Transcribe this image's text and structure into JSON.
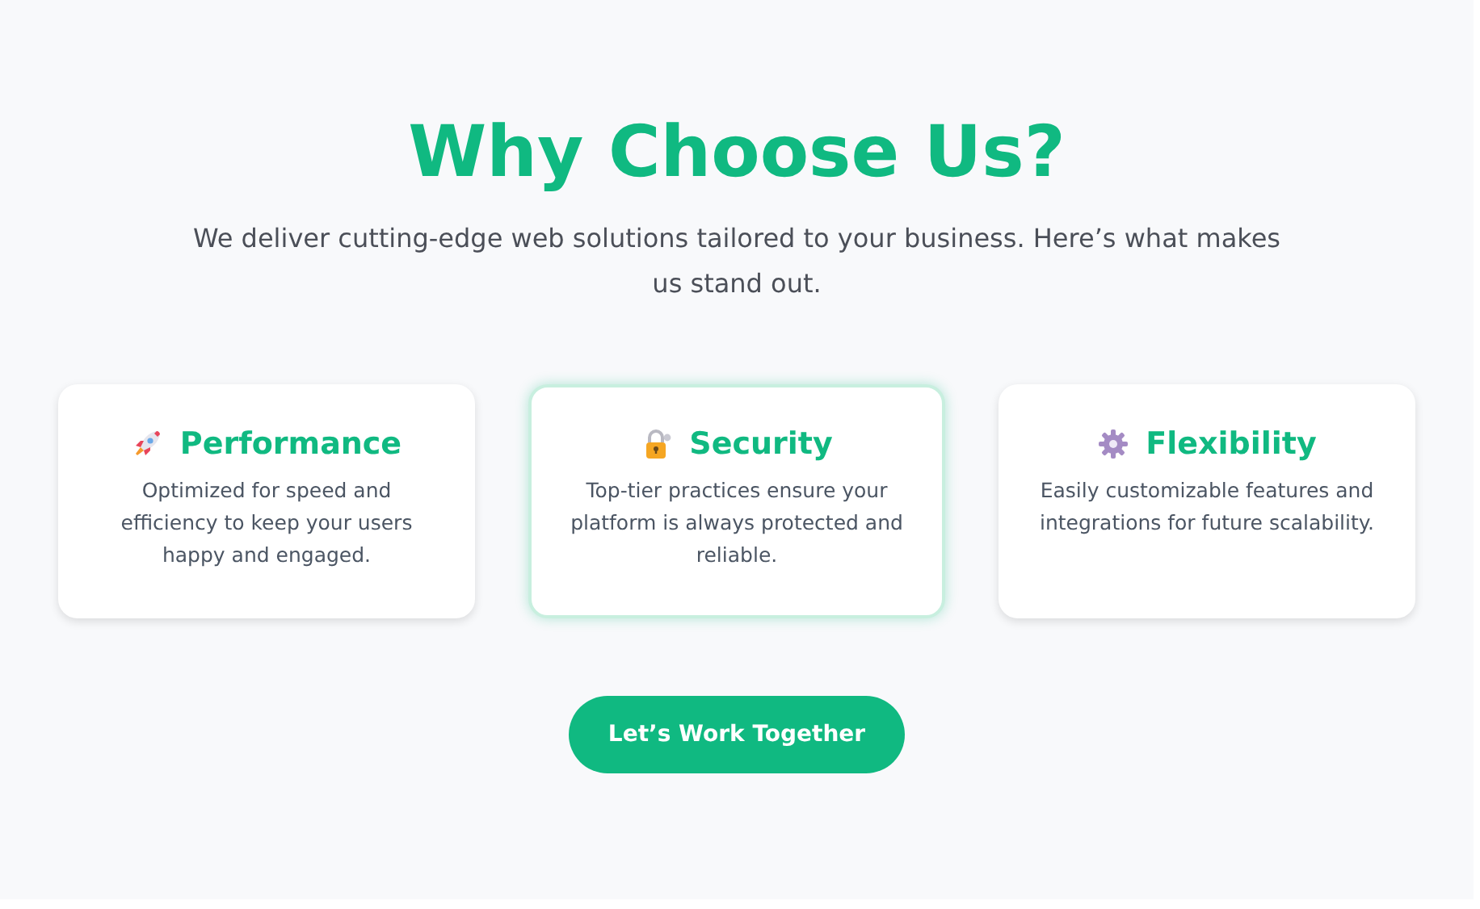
{
  "heading": "Why Choose Us?",
  "subtitle": "We deliver cutting-edge web solutions tailored to your business. Here’s what makes us stand out.",
  "features": [
    {
      "kind": "rocket",
      "title": "Performance",
      "text": "Optimized for speed and efficiency to keep your users happy and engaged.",
      "highlighted": false
    },
    {
      "kind": "lock",
      "title": "Security",
      "text": "Top-tier practices ensure your platform is always protected and reliable.",
      "highlighted": true
    },
    {
      "kind": "gear",
      "title": "Flexibility",
      "text": "Easily customizable features and integrations for future scalability.",
      "highlighted": false
    }
  ],
  "button": "Let’s Work Together"
}
